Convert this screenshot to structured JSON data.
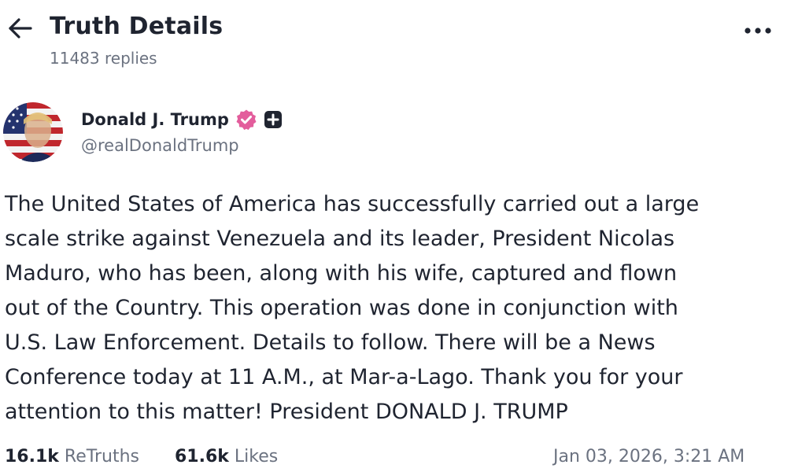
{
  "header": {
    "title": "Truth Details",
    "replies": "11483 replies",
    "back_icon": "arrow-left-icon",
    "more_icon": "more-horizontal-icon"
  },
  "author": {
    "display_name": "Donald J. Trump",
    "handle": "@realDonaldTrump",
    "verified_color": "#e35d9c"
  },
  "post": {
    "lines": [
      "The United States of America has successfully carried out a large",
      "scale strike against Venezuela and its leader, President Nicolas",
      "Maduro, who has been, along with his wife, captured and flown",
      "out of the Country. This operation was done in conjunction with",
      "U.S. Law Enforcement. Details to follow. There will be a News",
      "Conference today at 11 A.M., at Mar-a-Lago. Thank you for your",
      "attention to this matter! President DONALD J. TRUMP"
    ]
  },
  "stats": {
    "retruths_count": "16.1k",
    "retruths_label": "ReTruths",
    "likes_count": "61.6k",
    "likes_label": "Likes",
    "timestamp": "Jan 03, 2026, 3:21 AM"
  }
}
